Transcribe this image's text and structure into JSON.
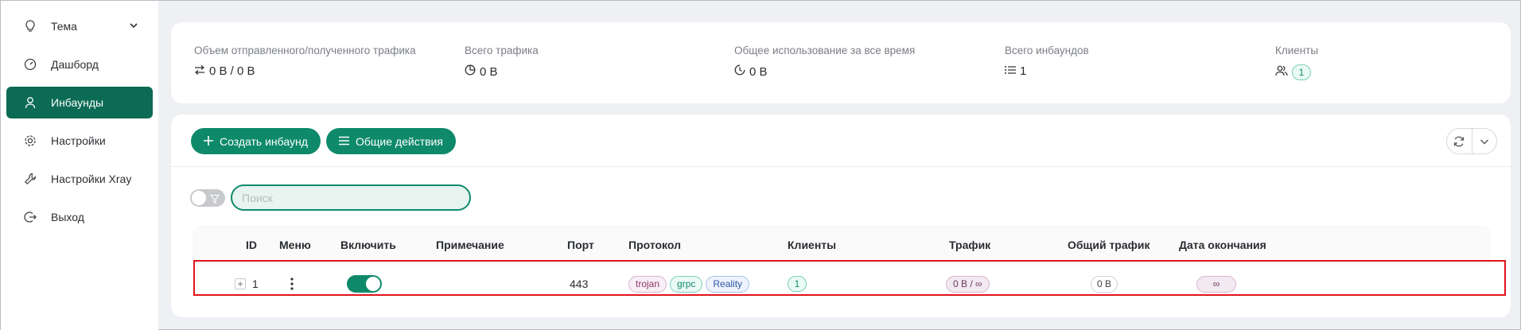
{
  "sidebar": {
    "items": [
      {
        "label": "Тема",
        "icon": "lightbulb-icon"
      },
      {
        "label": "Дашборд",
        "icon": "dashboard-icon"
      },
      {
        "label": "Инбаунды",
        "icon": "user-icon",
        "active": true
      },
      {
        "label": "Настройки",
        "icon": "gear-icon"
      },
      {
        "label": "Настройки Xray",
        "icon": "wrench-icon"
      },
      {
        "label": "Выход",
        "icon": "logout-icon"
      }
    ]
  },
  "stats": {
    "traffic_sent_received": {
      "label": "Объем отправленного/полученного трафика",
      "value": "0 B / 0 B"
    },
    "total_traffic": {
      "label": "Всего трафика",
      "value": "0 B"
    },
    "total_usage": {
      "label": "Общее использование за все время",
      "value": "0 B"
    },
    "total_inbounds": {
      "label": "Всего инбаундов",
      "value": "1"
    },
    "clients": {
      "label": "Клиенты",
      "value": "1"
    }
  },
  "toolbar": {
    "create_label": "Создать инбаунд",
    "actions_label": "Общие действия"
  },
  "search": {
    "placeholder": "Поиск",
    "value": ""
  },
  "table": {
    "headers": {
      "id": "ID",
      "menu": "Меню",
      "enable": "Включить",
      "remark": "Примечание",
      "port": "Порт",
      "protocol": "Протокол",
      "clients": "Клиенты",
      "traffic": "Трафик",
      "total_traffic": "Общий трафик",
      "expiry": "Дата окончания"
    },
    "rows": [
      {
        "id": "1",
        "enabled": true,
        "remark": "",
        "port": "443",
        "protocol_tags": [
          "trojan",
          "grpc",
          "Reality"
        ],
        "clients": "1",
        "traffic": "0 B / ∞",
        "total_traffic": "0 B",
        "expiry": "∞"
      }
    ]
  },
  "colors": {
    "accent": "#0e8a6a",
    "sidebar_active": "#0c6b55",
    "highlight": "#e0141c"
  }
}
